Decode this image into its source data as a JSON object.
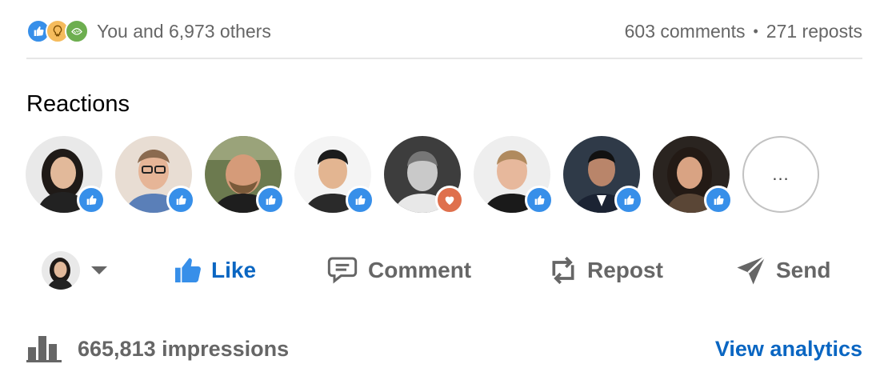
{
  "summary": {
    "reaction_icons": [
      "like-icon",
      "insightful-icon",
      "support-icon"
    ],
    "text": "You and 6,973 others",
    "comments": "603 comments",
    "separator": "•",
    "reposts": "271 reposts"
  },
  "reactions": {
    "title": "Reactions",
    "more_label": "...",
    "people": [
      {
        "reaction": "like"
      },
      {
        "reaction": "like"
      },
      {
        "reaction": "like"
      },
      {
        "reaction": "like"
      },
      {
        "reaction": "love"
      },
      {
        "reaction": "like"
      },
      {
        "reaction": "like"
      },
      {
        "reaction": "like"
      }
    ]
  },
  "actions": {
    "like": "Like",
    "comment": "Comment",
    "repost": "Repost",
    "send": "Send"
  },
  "footer": {
    "impressions": "665,813 impressions",
    "view_analytics": "View analytics"
  },
  "colors": {
    "accent": "#0a66c2",
    "like_badge": "#378fe9",
    "love_badge": "#df704d",
    "muted_text": "#666666"
  }
}
